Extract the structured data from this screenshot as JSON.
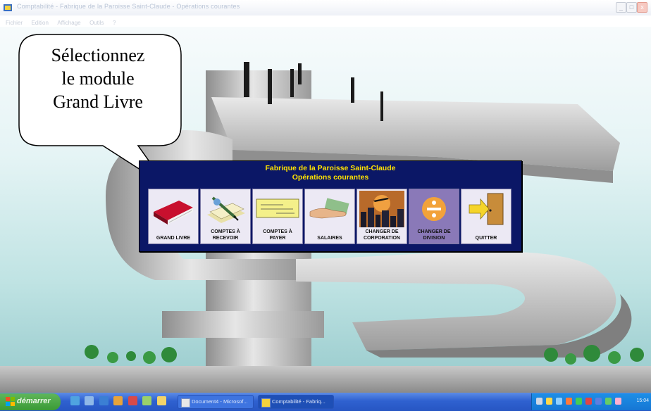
{
  "window": {
    "title": "Comptabilité - Fabrique de la Paroisse Saint-Claude - Opérations courantes",
    "controls": {
      "minimize": "_",
      "maximize": "□",
      "close": "x"
    }
  },
  "menubar": [
    "Fichier",
    "Edition",
    "Affichage",
    "Outils",
    "?"
  ],
  "callout": {
    "lines": [
      "Sélectionnez",
      "le module",
      "Grand Livre"
    ]
  },
  "panel": {
    "title_line1": "Fabrique de la Paroisse Saint-Claude",
    "title_line2": "Opérations courantes",
    "modules": [
      {
        "line1": "",
        "line2": "GRAND LIVRE",
        "icon": "ledger-book-icon"
      },
      {
        "line1": "COMPTES À",
        "line2": "RECEVOIR",
        "icon": "pen-and-papers-icon"
      },
      {
        "line1": "COMPTES À",
        "line2": "PAYER",
        "icon": "cheque-icon"
      },
      {
        "line1": "",
        "line2": "SALAIRES",
        "icon": "hand-with-money-icon"
      },
      {
        "line1": "CHANGER DE",
        "line2": "CORPORATION",
        "icon": "city-skyline-icon"
      },
      {
        "line1": "CHANGER DE",
        "line2": "DIVISION",
        "icon": "division-sign-icon"
      },
      {
        "line1": "",
        "line2": "QUITTER",
        "icon": "exit-door-icon"
      }
    ]
  },
  "taskbar": {
    "start_label": "démarrer",
    "tasks": [
      {
        "label": "Document4 - Microsof..."
      },
      {
        "label": "Comptabilité - Fabriq..."
      }
    ],
    "clock": "15:04"
  },
  "colors": {
    "panel_bg": "#0b1766",
    "panel_title": "#ffe300",
    "module_bg": "#ece9f4",
    "taskbar": "#2f61d0",
    "start": "#3a9a36"
  }
}
